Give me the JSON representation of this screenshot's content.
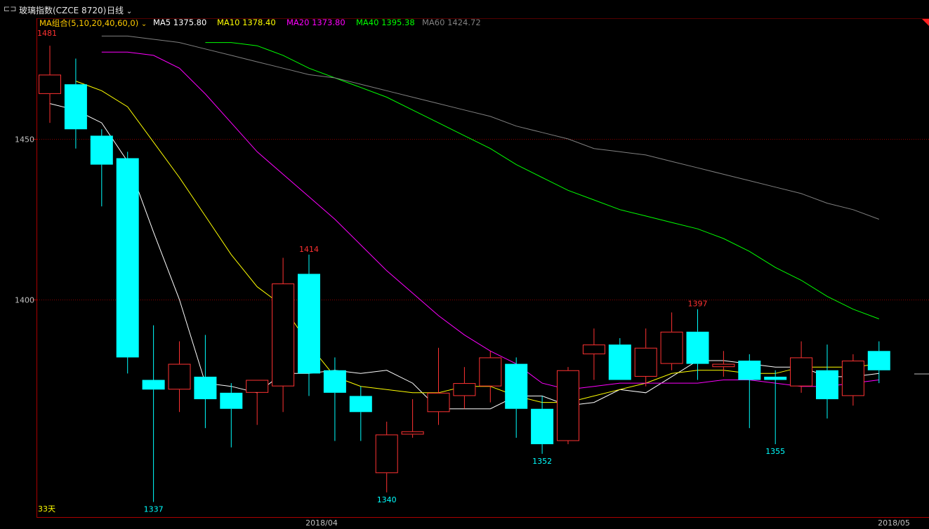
{
  "header": {
    "instrument": "玻璃指数(CZCE 8720)",
    "period": "日线",
    "ma_combo": "MA组合(5,10,20,40,60,0)",
    "ma_values": [
      {
        "label": "MA5 1375.80",
        "color": "#ffffff"
      },
      {
        "label": "MA10 1378.40",
        "color": "#ffff00"
      },
      {
        "label": "MA20 1373.80",
        "color": "#ff00ff"
      },
      {
        "label": "MA40 1395.38",
        "color": "#00ff00"
      },
      {
        "label": "MA60 1424.72",
        "color": "#808080"
      }
    ]
  },
  "footer": {
    "days_label": "33天",
    "x_ticks": [
      "2018/04",
      "2018/05"
    ]
  },
  "colors": {
    "up": "#ff3232",
    "down": "#00ffff",
    "grid": "#8b0000",
    "axis": "#aa0000",
    "label": "#c0c0c0"
  },
  "chart_data": {
    "type": "candlestick",
    "y_ticks": [
      1450,
      1400
    ],
    "ylim": [
      1330,
      1487
    ],
    "candles": [
      {
        "o": 1464,
        "h": 1479,
        "l": 1455,
        "c": 1470
      },
      {
        "o": 1467,
        "h": 1475,
        "l": 1447,
        "c": 1453
      },
      {
        "o": 1451,
        "h": 1453,
        "l": 1429,
        "c": 1442
      },
      {
        "o": 1444,
        "h": 1446,
        "l": 1377,
        "c": 1382
      },
      {
        "o": 1375,
        "h": 1392,
        "l": 1337,
        "c": 1372
      },
      {
        "o": 1372,
        "h": 1387,
        "l": 1365,
        "c": 1380
      },
      {
        "o": 1376,
        "h": 1389,
        "l": 1360,
        "c": 1369
      },
      {
        "o": 1371,
        "h": 1374,
        "l": 1354,
        "c": 1366
      },
      {
        "o": 1371,
        "h": 1375,
        "l": 1361,
        "c": 1375
      },
      {
        "o": 1373,
        "h": 1413,
        "l": 1365,
        "c": 1405
      },
      {
        "o": 1408,
        "h": 1414,
        "l": 1370,
        "c": 1377
      },
      {
        "o": 1378,
        "h": 1382,
        "l": 1356,
        "c": 1371
      },
      {
        "o": 1370,
        "h": 1373,
        "l": 1356,
        "c": 1365
      },
      {
        "o": 1346,
        "h": 1362,
        "l": 1340,
        "c": 1358
      },
      {
        "o": 1358,
        "h": 1369,
        "l": 1357,
        "c": 1359
      },
      {
        "o": 1365,
        "h": 1385,
        "l": 1361,
        "c": 1371
      },
      {
        "o": 1370,
        "h": 1379,
        "l": 1366,
        "c": 1374
      },
      {
        "o": 1373,
        "h": 1384,
        "l": 1368,
        "c": 1382
      },
      {
        "o": 1380,
        "h": 1382,
        "l": 1357,
        "c": 1366
      },
      {
        "o": 1366,
        "h": 1370,
        "l": 1352,
        "c": 1355
      },
      {
        "o": 1356,
        "h": 1379,
        "l": 1355,
        "c": 1378
      },
      {
        "o": 1383,
        "h": 1391,
        "l": 1375,
        "c": 1386
      },
      {
        "o": 1386,
        "h": 1388,
        "l": 1375,
        "c": 1375
      },
      {
        "o": 1376,
        "h": 1391,
        "l": 1373,
        "c": 1385
      },
      {
        "o": 1380,
        "h": 1396,
        "l": 1378,
        "c": 1390
      },
      {
        "o": 1390,
        "h": 1397,
        "l": 1375,
        "c": 1380
      },
      {
        "o": 1379,
        "h": 1384,
        "l": 1376,
        "c": 1380
      },
      {
        "o": 1381,
        "h": 1383,
        "l": 1360,
        "c": 1375
      },
      {
        "o": 1376,
        "h": 1378,
        "l": 1355,
        "c": 1375
      },
      {
        "o": 1373,
        "h": 1387,
        "l": 1371,
        "c": 1382
      },
      {
        "o": 1378,
        "h": 1386,
        "l": 1363,
        "c": 1369
      },
      {
        "o": 1370,
        "h": 1383,
        "l": 1367,
        "c": 1381
      },
      {
        "o": 1384,
        "h": 1387,
        "l": 1374,
        "c": 1378
      }
    ],
    "price_labels": [
      {
        "text": "1481",
        "index": 0,
        "value": 1481,
        "kind": "up"
      },
      {
        "text": "1414",
        "index": 10,
        "value": 1414,
        "kind": "up"
      },
      {
        "text": "1397",
        "index": 25,
        "value": 1397,
        "kind": "up"
      },
      {
        "text": "1337",
        "index": 4,
        "value": 1337,
        "kind": "down"
      },
      {
        "text": "1340",
        "index": 13,
        "value": 1340,
        "kind": "down"
      },
      {
        "text": "1352",
        "index": 19,
        "value": 1352,
        "kind": "down"
      },
      {
        "text": "1355",
        "index": 28,
        "value": 1355,
        "kind": "down"
      }
    ],
    "series": [
      {
        "name": "MA5",
        "color": "#ffffff",
        "values": [
          1461,
          1459,
          1455,
          1443,
          1421,
          1400,
          1374,
          1373,
          1371,
          1377,
          1377,
          1378,
          1377,
          1378,
          1374,
          1366,
          1366,
          1366,
          1370,
          1370,
          1367,
          1368,
          1372,
          1371,
          1376,
          1381,
          1381,
          1380,
          1379,
          1379,
          1376,
          1376,
          1377
        ]
      },
      {
        "name": "MA10",
        "color": "#ffff00",
        "values": [
          1468,
          1465,
          1460,
          1449,
          1438,
          1426,
          1414,
          1404,
          1398,
          1386,
          1376,
          1373,
          1372,
          1371,
          1371,
          1373,
          1373,
          1370,
          1368,
          1368,
          1370,
          1372,
          1374,
          1377,
          1378,
          1378,
          1377,
          1377,
          1379,
          1379,
          1379,
          1380
        ]
      },
      {
        "name": "MA20",
        "color": "#ff00ff",
        "values": [
          1477,
          1477,
          1476,
          1472,
          1464,
          1455,
          1446,
          1439,
          1432,
          1425,
          1417,
          1409,
          1402,
          1395,
          1389,
          1384,
          1380,
          1374,
          1372,
          1373,
          1374,
          1374,
          1374,
          1374,
          1375,
          1375,
          1374,
          1373,
          1373,
          1374,
          1375
        ]
      },
      {
        "name": "MA40",
        "color": "#00ff00",
        "values": [
          1480,
          1480,
          1479,
          1476,
          1472,
          1469,
          1466,
          1463,
          1459,
          1455,
          1451,
          1447,
          1442,
          1438,
          1434,
          1431,
          1428,
          1426,
          1424,
          1422,
          1419,
          1415,
          1410,
          1406,
          1401,
          1397,
          1394
        ]
      },
      {
        "name": "MA60",
        "color": "#808080",
        "values": [
          1482,
          1482,
          1481,
          1480,
          1478,
          1476,
          1474,
          1472,
          1470,
          1469,
          1467,
          1465,
          1463,
          1461,
          1459,
          1457,
          1454,
          1452,
          1450,
          1447,
          1446,
          1445,
          1443,
          1441,
          1439,
          1437,
          1435,
          1433,
          1430,
          1428,
          1425
        ]
      }
    ]
  }
}
